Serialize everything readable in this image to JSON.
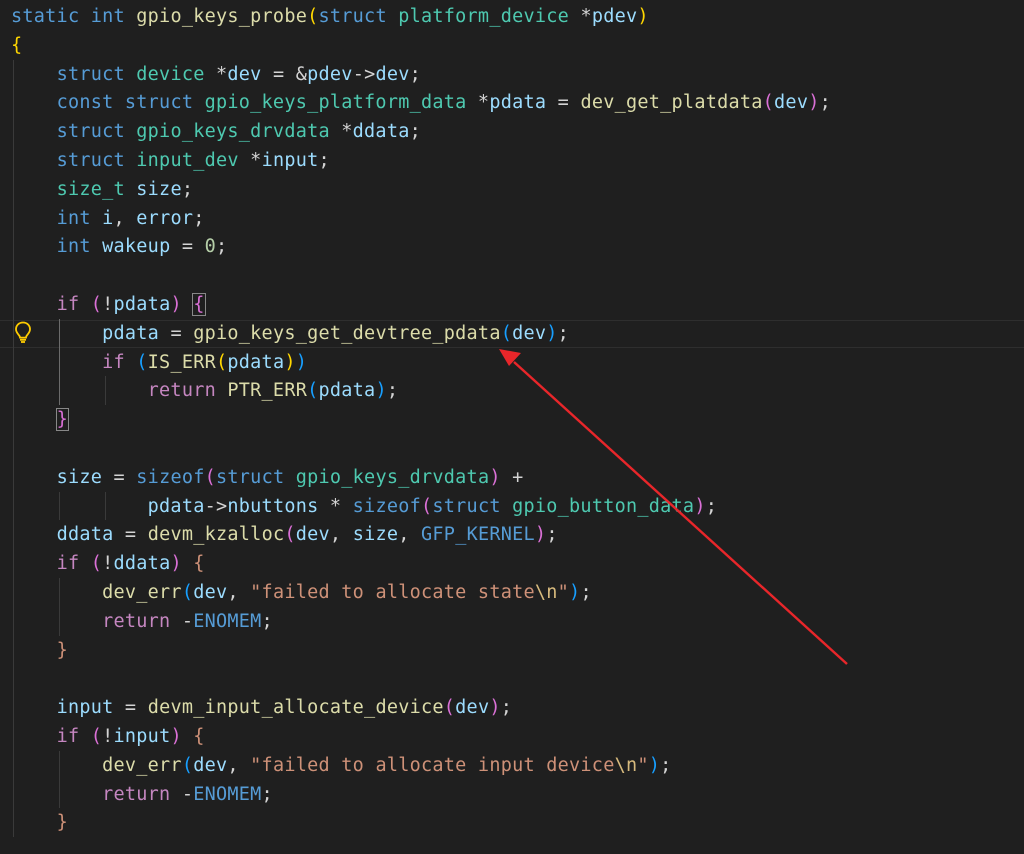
{
  "editor": {
    "lines": [
      [
        [
          "kw",
          "static "
        ],
        [
          "kw",
          "int "
        ],
        [
          "fn",
          "gpio_keys_probe"
        ],
        [
          "p1",
          "("
        ],
        [
          "kw",
          "struct "
        ],
        [
          "ty",
          "platform_device "
        ],
        [
          "op",
          "*"
        ],
        [
          "var",
          "pdev"
        ],
        [
          "p1",
          ")"
        ]
      ],
      [
        [
          "p1",
          "{"
        ]
      ],
      [
        [
          "op",
          "    "
        ],
        [
          "kw",
          "struct "
        ],
        [
          "ty",
          "device "
        ],
        [
          "op",
          "*"
        ],
        [
          "var",
          "dev"
        ],
        [
          "op",
          " = &"
        ],
        [
          "var",
          "pdev"
        ],
        [
          "op",
          "->"
        ],
        [
          "var",
          "dev"
        ],
        [
          "op",
          ";"
        ]
      ],
      [
        [
          "op",
          "    "
        ],
        [
          "kw",
          "const "
        ],
        [
          "kw",
          "struct "
        ],
        [
          "ty",
          "gpio_keys_platform_data "
        ],
        [
          "op",
          "*"
        ],
        [
          "var",
          "pdata"
        ],
        [
          "op",
          " = "
        ],
        [
          "fn",
          "dev_get_platdata"
        ],
        [
          "p2",
          "("
        ],
        [
          "var",
          "dev"
        ],
        [
          "p2",
          ")"
        ],
        [
          "op",
          ";"
        ]
      ],
      [
        [
          "op",
          "    "
        ],
        [
          "kw",
          "struct "
        ],
        [
          "ty",
          "gpio_keys_drvdata "
        ],
        [
          "op",
          "*"
        ],
        [
          "var",
          "ddata"
        ],
        [
          "op",
          ";"
        ]
      ],
      [
        [
          "op",
          "    "
        ],
        [
          "kw",
          "struct "
        ],
        [
          "ty",
          "input_dev "
        ],
        [
          "op",
          "*"
        ],
        [
          "var",
          "input"
        ],
        [
          "op",
          ";"
        ]
      ],
      [
        [
          "op",
          "    "
        ],
        [
          "ty",
          "size_t "
        ],
        [
          "var",
          "size"
        ],
        [
          "op",
          ";"
        ]
      ],
      [
        [
          "op",
          "    "
        ],
        [
          "kw",
          "int "
        ],
        [
          "var",
          "i"
        ],
        [
          "op",
          ", "
        ],
        [
          "var",
          "error"
        ],
        [
          "op",
          ";"
        ]
      ],
      [
        [
          "op",
          "    "
        ],
        [
          "kw",
          "int "
        ],
        [
          "var",
          "wakeup"
        ],
        [
          "op",
          " = "
        ],
        [
          "num",
          "0"
        ],
        [
          "op",
          ";"
        ]
      ],
      [],
      [
        [
          "op",
          "    "
        ],
        [
          "ctl",
          "if "
        ],
        [
          "p2",
          "("
        ],
        [
          "op",
          "!"
        ],
        [
          "var",
          "pdata"
        ],
        [
          "p2",
          ")"
        ],
        [
          "op",
          " "
        ],
        [
          "p2",
          "{"
        ]
      ],
      [
        [
          "op",
          "        "
        ],
        [
          "var",
          "pdata"
        ],
        [
          "op",
          " = "
        ],
        [
          "fn",
          "gpio_keys_get_devtree_pdata"
        ],
        [
          "p3",
          "("
        ],
        [
          "var",
          "dev"
        ],
        [
          "p3",
          ")"
        ],
        [
          "op",
          ";"
        ]
      ],
      [
        [
          "op",
          "        "
        ],
        [
          "ctl",
          "if "
        ],
        [
          "p3",
          "("
        ],
        [
          "fn",
          "IS_ERR"
        ],
        [
          "p1",
          "("
        ],
        [
          "var",
          "pdata"
        ],
        [
          "p1",
          ")"
        ],
        [
          "p3",
          ")"
        ]
      ],
      [
        [
          "op",
          "            "
        ],
        [
          "ctl",
          "return "
        ],
        [
          "fn",
          "PTR_ERR"
        ],
        [
          "p3",
          "("
        ],
        [
          "var",
          "pdata"
        ],
        [
          "p3",
          ")"
        ],
        [
          "op",
          ";"
        ]
      ],
      [
        [
          "op",
          "    "
        ],
        [
          "p2",
          "}"
        ]
      ],
      [],
      [
        [
          "op",
          "    "
        ],
        [
          "var",
          "size"
        ],
        [
          "op",
          " = "
        ],
        [
          "kw",
          "sizeof"
        ],
        [
          "p2",
          "("
        ],
        [
          "kw",
          "struct "
        ],
        [
          "ty",
          "gpio_keys_drvdata"
        ],
        [
          "p2",
          ")"
        ],
        [
          "op",
          " +"
        ]
      ],
      [
        [
          "op",
          "            "
        ],
        [
          "var",
          "pdata"
        ],
        [
          "op",
          "->"
        ],
        [
          "var",
          "nbuttons"
        ],
        [
          "op",
          " * "
        ],
        [
          "kw",
          "sizeof"
        ],
        [
          "p2",
          "("
        ],
        [
          "kw",
          "struct "
        ],
        [
          "ty",
          "gpio_button_data"
        ],
        [
          "p2",
          ")"
        ],
        [
          "op",
          ";"
        ]
      ],
      [
        [
          "op",
          "    "
        ],
        [
          "var",
          "ddata"
        ],
        [
          "op",
          " = "
        ],
        [
          "fn",
          "devm_kzalloc"
        ],
        [
          "p2",
          "("
        ],
        [
          "var",
          "dev"
        ],
        [
          "op",
          ", "
        ],
        [
          "var",
          "size"
        ],
        [
          "op",
          ", "
        ],
        [
          "mac",
          "GFP_KERNEL"
        ],
        [
          "p2",
          ")"
        ],
        [
          "op",
          ";"
        ]
      ],
      [
        [
          "op",
          "    "
        ],
        [
          "ctl",
          "if "
        ],
        [
          "p2",
          "("
        ],
        [
          "op",
          "!"
        ],
        [
          "var",
          "ddata"
        ],
        [
          "p2",
          ")"
        ],
        [
          "op",
          " "
        ],
        [
          "str",
          "{"
        ]
      ],
      [
        [
          "op",
          "        "
        ],
        [
          "fn",
          "dev_err"
        ],
        [
          "p3",
          "("
        ],
        [
          "var",
          "dev"
        ],
        [
          "op",
          ", "
        ],
        [
          "str",
          "\"failed to allocate state"
        ],
        [
          "esc",
          "\\n"
        ],
        [
          "str",
          "\""
        ],
        [
          "p3",
          ")"
        ],
        [
          "op",
          ";"
        ]
      ],
      [
        [
          "op",
          "        "
        ],
        [
          "ctl",
          "return "
        ],
        [
          "op",
          "-"
        ],
        [
          "mac",
          "ENOMEM"
        ],
        [
          "op",
          ";"
        ]
      ],
      [
        [
          "op",
          "    "
        ],
        [
          "str",
          "}"
        ]
      ],
      [],
      [
        [
          "op",
          "    "
        ],
        [
          "var",
          "input"
        ],
        [
          "op",
          " = "
        ],
        [
          "fn",
          "devm_input_allocate_device"
        ],
        [
          "p2",
          "("
        ],
        [
          "var",
          "dev"
        ],
        [
          "p2",
          ")"
        ],
        [
          "op",
          ";"
        ]
      ],
      [
        [
          "op",
          "    "
        ],
        [
          "ctl",
          "if "
        ],
        [
          "p2",
          "("
        ],
        [
          "op",
          "!"
        ],
        [
          "var",
          "input"
        ],
        [
          "p2",
          ")"
        ],
        [
          "op",
          " "
        ],
        [
          "str",
          "{"
        ]
      ],
      [
        [
          "op",
          "        "
        ],
        [
          "fn",
          "dev_err"
        ],
        [
          "p3",
          "("
        ],
        [
          "var",
          "dev"
        ],
        [
          "op",
          ", "
        ],
        [
          "str",
          "\"failed to allocate input device"
        ],
        [
          "esc",
          "\\n"
        ],
        [
          "str",
          "\""
        ],
        [
          "p3",
          ")"
        ],
        [
          "op",
          ";"
        ]
      ],
      [
        [
          "op",
          "        "
        ],
        [
          "ctl",
          "return "
        ],
        [
          "op",
          "-"
        ],
        [
          "mac",
          "ENOMEM"
        ],
        [
          "op",
          ";"
        ]
      ],
      [
        [
          "op",
          "    "
        ],
        [
          "str",
          "}"
        ]
      ]
    ],
    "current_line": 12,
    "colors": {
      "background": "#1f1f1f",
      "keyword": "#569cd6",
      "type": "#4ec9b0",
      "function": "#dcdcaa",
      "variable": "#9cdcfe",
      "string": "#ce9178",
      "arrow": "#e8262a",
      "bulb": "#ffcc00"
    },
    "gutter_icon": "lightbulb-icon",
    "annotation": "red-arrow"
  }
}
